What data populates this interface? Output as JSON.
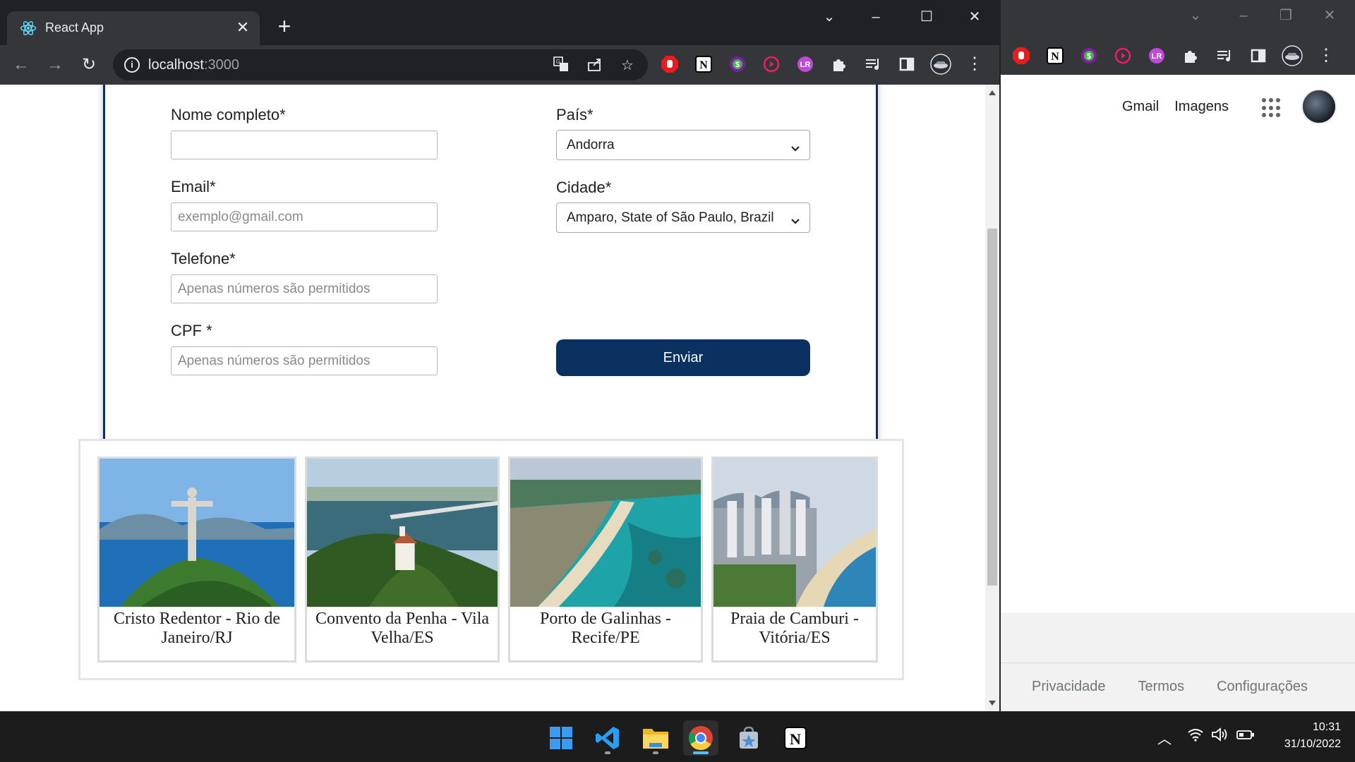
{
  "browser": {
    "tab_title": "React App",
    "tab_close": "✕",
    "new_tab": "+",
    "url_host": "localhost",
    "url_port": ":3000"
  },
  "form": {
    "fields": [
      {
        "label": "Nome completo*",
        "value": "",
        "placeholder": ""
      },
      {
        "label": "Email*",
        "value": "",
        "placeholder": "exemplo@gmail.com"
      },
      {
        "label": "Telefone*",
        "value": "",
        "placeholder": "Apenas números são permitidos"
      },
      {
        "label": "CPF *",
        "value": "",
        "placeholder": "Apenas números são permitidos"
      }
    ],
    "country": {
      "label": "País*",
      "selected": "Andorra"
    },
    "city": {
      "label": "Cidade*",
      "selected": "Amparo, State of São Paulo, Brazil"
    },
    "submit_label": "Enviar"
  },
  "gallery": {
    "items": [
      {
        "caption": "Cristo Redentor - Rio de Janeiro/RJ"
      },
      {
        "caption": "Convento da Penha - Vila Velha/ES"
      },
      {
        "caption": "Porto de Galinhas - Recife/PE"
      },
      {
        "caption": "Praia de Camburi - Vitória/ES"
      }
    ]
  },
  "background_window": {
    "links": [
      "Gmail",
      "Imagens"
    ],
    "footer_links": [
      "Privacidade",
      "Termos",
      "Configurações"
    ]
  },
  "taskbar": {
    "time": "10:31",
    "date": "31/10/2022"
  },
  "colors": {
    "primary": "#0b3161",
    "chrome_dark": "#202124",
    "chrome_toolbar": "#35363a"
  }
}
